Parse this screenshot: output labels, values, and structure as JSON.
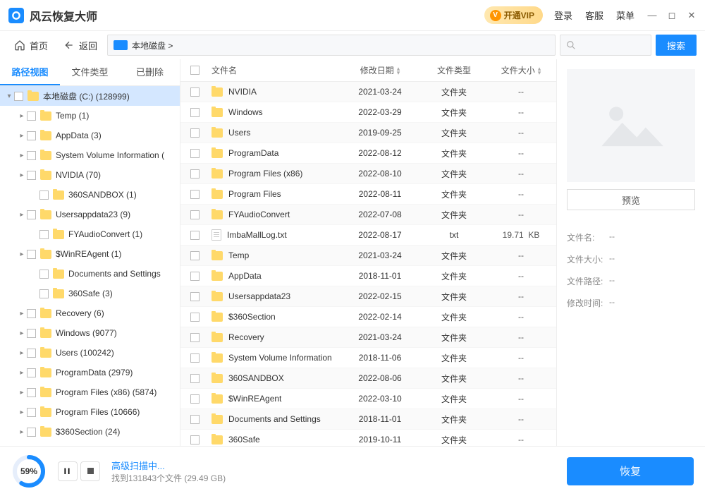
{
  "app": {
    "title": "风云恢复大师"
  },
  "titlebar": {
    "vip": "开通VIP",
    "login": "登录",
    "support": "客服",
    "menu": "菜单"
  },
  "toolbar": {
    "home": "首页",
    "back": "返回",
    "crumb": "本地磁盘 >",
    "search_btn": "搜索"
  },
  "sidebar": {
    "tabs": [
      "路径视图",
      "文件类型",
      "已删除"
    ],
    "tree": [
      {
        "label": "本地磁盘 (C:) (128999)",
        "depth": 0,
        "caret": "▾",
        "sel": true
      },
      {
        "label": "Temp (1)",
        "depth": 1,
        "caret": "▸"
      },
      {
        "label": "AppData (3)",
        "depth": 1,
        "caret": "▸"
      },
      {
        "label": "System Volume Information (",
        "depth": 1,
        "caret": "▸"
      },
      {
        "label": "NVIDIA (70)",
        "depth": 1,
        "caret": "▸"
      },
      {
        "label": "360SANDBOX (1)",
        "depth": 2,
        "caret": ""
      },
      {
        "label": "Usersappdata23 (9)",
        "depth": 1,
        "caret": "▸"
      },
      {
        "label": "FYAudioConvert (1)",
        "depth": 2,
        "caret": ""
      },
      {
        "label": "$WinREAgent (1)",
        "depth": 1,
        "caret": "▸"
      },
      {
        "label": "Documents and Settings",
        "depth": 2,
        "caret": ""
      },
      {
        "label": "360Safe (3)",
        "depth": 2,
        "caret": ""
      },
      {
        "label": "Recovery (6)",
        "depth": 1,
        "caret": "▸"
      },
      {
        "label": "Windows (9077)",
        "depth": 1,
        "caret": "▸"
      },
      {
        "label": "Users (100242)",
        "depth": 1,
        "caret": "▸"
      },
      {
        "label": "ProgramData (2979)",
        "depth": 1,
        "caret": "▸"
      },
      {
        "label": "Program Files (x86) (5874)",
        "depth": 1,
        "caret": "▸"
      },
      {
        "label": "Program Files (10666)",
        "depth": 1,
        "caret": "▸"
      },
      {
        "label": "$360Section (24)",
        "depth": 1,
        "caret": "▸"
      }
    ]
  },
  "columns": {
    "name": "文件名",
    "date": "修改日期",
    "type": "文件类型",
    "size": "文件大小"
  },
  "files": [
    {
      "name": "NVIDIA",
      "date": "2021-03-24",
      "type": "文件夹",
      "size": "--",
      "icon": "folder"
    },
    {
      "name": "Windows",
      "date": "2022-03-29",
      "type": "文件夹",
      "size": "--",
      "icon": "folder"
    },
    {
      "name": "Users",
      "date": "2019-09-25",
      "type": "文件夹",
      "size": "--",
      "icon": "folder"
    },
    {
      "name": "ProgramData",
      "date": "2022-08-12",
      "type": "文件夹",
      "size": "--",
      "icon": "folder"
    },
    {
      "name": "Program Files (x86)",
      "date": "2022-08-10",
      "type": "文件夹",
      "size": "--",
      "icon": "folder"
    },
    {
      "name": "Program Files",
      "date": "2022-08-11",
      "type": "文件夹",
      "size": "--",
      "icon": "folder"
    },
    {
      "name": "FYAudioConvert",
      "date": "2022-07-08",
      "type": "文件夹",
      "size": "--",
      "icon": "folder"
    },
    {
      "name": "ImbaMallLog.txt",
      "date": "2022-08-17",
      "type": "txt",
      "size": "19.71  KB",
      "icon": "doc"
    },
    {
      "name": "Temp",
      "date": "2021-03-24",
      "type": "文件夹",
      "size": "--",
      "icon": "folder"
    },
    {
      "name": "AppData",
      "date": "2018-11-01",
      "type": "文件夹",
      "size": "--",
      "icon": "folder"
    },
    {
      "name": "Usersappdata23",
      "date": "2022-02-15",
      "type": "文件夹",
      "size": "--",
      "icon": "folder"
    },
    {
      "name": "$360Section",
      "date": "2022-02-14",
      "type": "文件夹",
      "size": "--",
      "icon": "folder"
    },
    {
      "name": "Recovery",
      "date": "2021-03-24",
      "type": "文件夹",
      "size": "--",
      "icon": "folder"
    },
    {
      "name": "System Volume Information",
      "date": "2018-11-06",
      "type": "文件夹",
      "size": "--",
      "icon": "folder"
    },
    {
      "name": "360SANDBOX",
      "date": "2022-08-06",
      "type": "文件夹",
      "size": "--",
      "icon": "folder"
    },
    {
      "name": "$WinREAgent",
      "date": "2022-03-10",
      "type": "文件夹",
      "size": "--",
      "icon": "folder"
    },
    {
      "name": "Documents and Settings",
      "date": "2018-11-01",
      "type": "文件夹",
      "size": "--",
      "icon": "folder"
    },
    {
      "name": "360Safe",
      "date": "2019-10-11",
      "type": "文件夹",
      "size": "--",
      "icon": "folder"
    }
  ],
  "preview": {
    "btn": "预览",
    "rows": [
      {
        "label": "文件名:",
        "value": "--"
      },
      {
        "label": "文件大小:",
        "value": "--"
      },
      {
        "label": "文件路径:",
        "value": "--"
      },
      {
        "label": "修改时间:",
        "value": "--"
      }
    ]
  },
  "bottom": {
    "pct": "59%",
    "title": "高级扫描中...",
    "sub": "找到131843个文件 (29.49 GB)",
    "recover": "恢复"
  }
}
